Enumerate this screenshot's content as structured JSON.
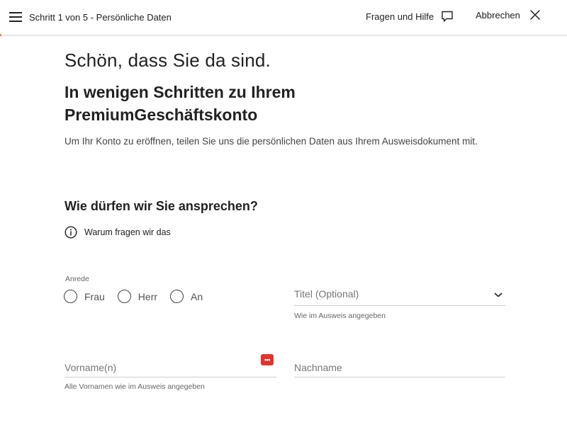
{
  "header": {
    "step_title": "Schritt 1 von 5 - Persönliche Daten",
    "help_label": "Fragen und Hilfe",
    "cancel_label": "Abbrechen",
    "accent_color": "#f39200",
    "icons": {
      "menu": "hamburger-icon",
      "help": "chat-bubble-icon",
      "cancel": "close-icon"
    }
  },
  "intro": {
    "welcome": "Schön, dass Sie da sind.",
    "headline": "In wenigen Schritten zu Ihrem PremiumGeschäftskonto",
    "description": "Um Ihr Konto zu eröffnen, teilen Sie uns die persönlichen Daten aus Ihrem Ausweisdokument mit."
  },
  "form": {
    "section_title": "Wie dürfen wir Sie ansprechen?",
    "info_link": "Warum fragen wir das",
    "salutation": {
      "label": "Anrede",
      "options": [
        "Frau",
        "Herr",
        "An"
      ]
    },
    "title_select": {
      "placeholder": "Titel (Optional)",
      "hint": "Wie im Ausweis angegeben"
    },
    "first_name": {
      "placeholder": "Vorname(n)",
      "value": "",
      "hint": "Alle Vornamen wie im Ausweis angegeben"
    },
    "last_name": {
      "placeholder": "Nachname",
      "value": ""
    },
    "password_manager_badge": "•••"
  }
}
